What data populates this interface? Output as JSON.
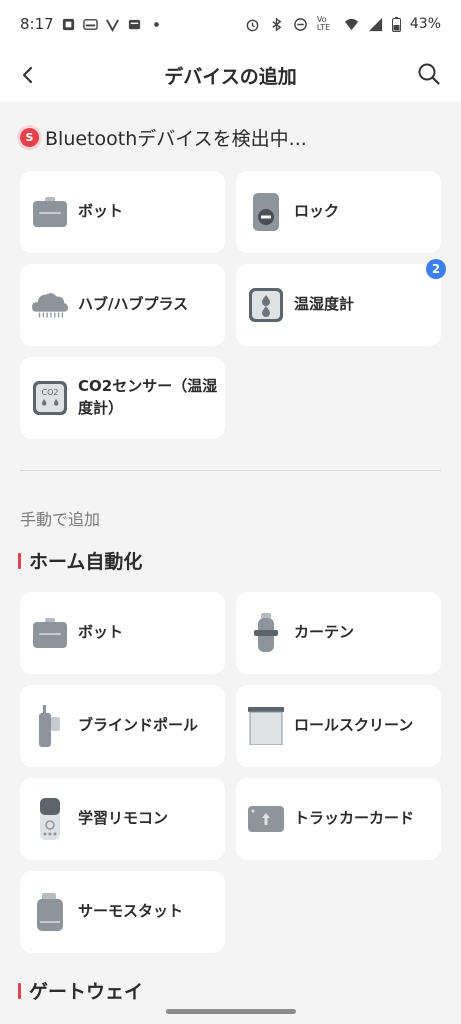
{
  "status_bar": {
    "time": "8:17",
    "battery": "43%",
    "lte_label": "Vo LTE"
  },
  "app_bar": {
    "title": "デバイスの追加"
  },
  "scan": {
    "logo_letter": "S",
    "title": "Bluetoothデバイスを検出中..."
  },
  "detected_devices": [
    {
      "label": "ボット",
      "icon": "bot-icon"
    },
    {
      "label": "ロック",
      "icon": "lock-icon"
    },
    {
      "label": "ハブ/ハブプラス",
      "icon": "hub-icon"
    },
    {
      "label": "温湿度計",
      "icon": "meter-icon",
      "badge": "2"
    },
    {
      "label": "CO2センサー（温湿度計）",
      "icon": "co2-sensor-icon"
    }
  ],
  "manual": {
    "label": "手動で追加"
  },
  "sections": {
    "home_automation": {
      "title": "ホーム自動化",
      "items": [
        {
          "label": "ボット",
          "icon": "bot-icon"
        },
        {
          "label": "カーテン",
          "icon": "curtain-icon"
        },
        {
          "label": "ブラインドポール",
          "icon": "blind-tilt-icon"
        },
        {
          "label": "ロールスクリーン",
          "icon": "roller-shade-icon"
        },
        {
          "label": "学習リモコン",
          "icon": "remote-icon"
        },
        {
          "label": "トラッカーカード",
          "icon": "tracker-card-icon"
        },
        {
          "label": "サーモスタット",
          "icon": "thermostat-icon"
        }
      ]
    },
    "gateway": {
      "title": "ゲートウェイ"
    }
  },
  "colors": {
    "accent_red": "#e8414b",
    "badge_blue": "#3d7ef1",
    "device_gray": "#8e949c"
  }
}
